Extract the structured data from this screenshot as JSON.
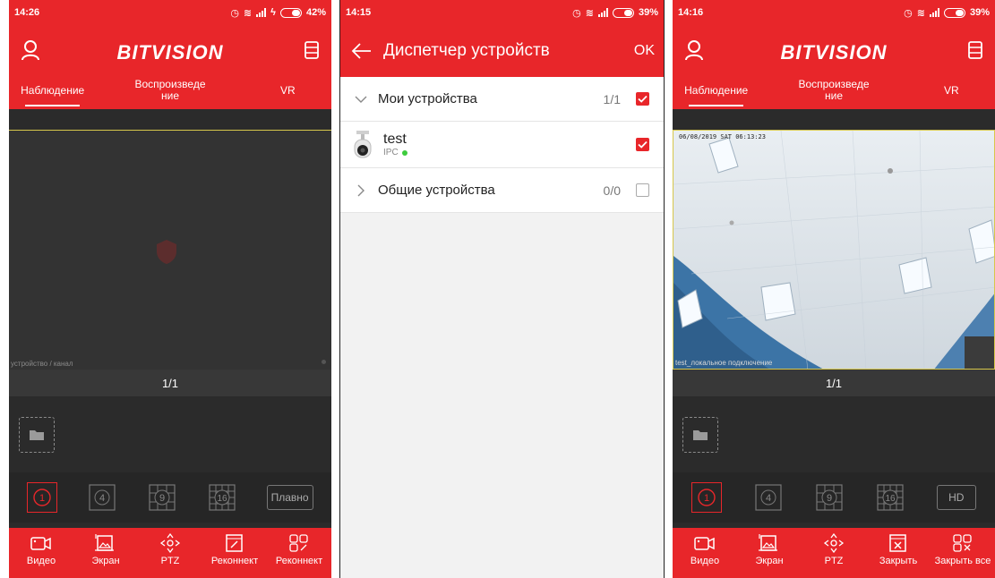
{
  "panel_left": {
    "time": "14:26",
    "battery": "42%",
    "brand": "BITVISION",
    "tabs": [
      "Наблюдение",
      "Воспроизведе ние",
      "VR"
    ],
    "channel_label": "устройство / канал",
    "page_indicator": "1/1",
    "layouts": [
      "1",
      "4",
      "9",
      "16"
    ],
    "smooth_label": "Плавно",
    "toolbar": [
      "Видео",
      "Экран",
      "PTZ",
      "Реконнект",
      "Реконнект"
    ]
  },
  "panel_middle": {
    "time": "14:15",
    "battery": "39%",
    "title": "Диспетчер устройств",
    "ok_label": "OK",
    "my_devices_label": "Мои устройства",
    "my_devices_count": "1/1",
    "device_name": "test",
    "device_type": "IPC",
    "shared_devices_label": "Общие устройства",
    "shared_devices_count": "0/0"
  },
  "panel_right": {
    "time": "14:16",
    "battery": "39%",
    "brand": "BITVISION",
    "tabs": [
      "Наблюдение",
      "Воспроизведе ние",
      "VR"
    ],
    "osd_timestamp": "06/08/2019 SAT 06:13:23",
    "channel_label": "test_локальное подключение",
    "page_indicator": "1/1",
    "layouts": [
      "1",
      "4",
      "9",
      "16"
    ],
    "hd_label": "HD",
    "toolbar": [
      "Видео",
      "Экран",
      "PTZ",
      "Закрыть",
      "Закрыть все"
    ]
  },
  "colors": {
    "accent": "#e8262a",
    "dark_bg": "#2b2b2b",
    "online": "#3dcc3d"
  }
}
